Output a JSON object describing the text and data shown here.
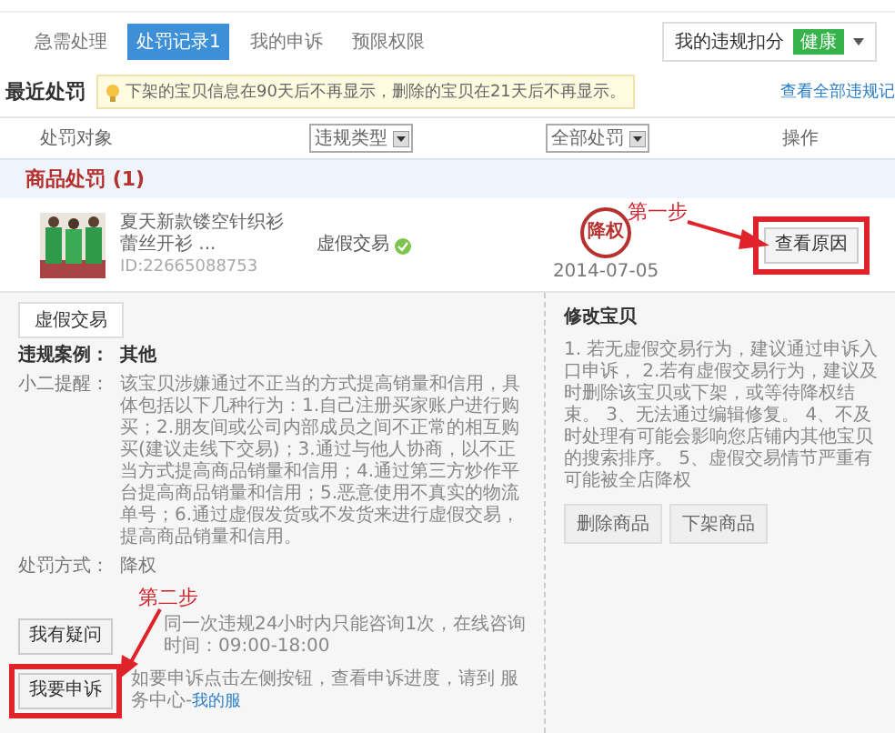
{
  "tabs": [
    {
      "label": "急需处理",
      "selected": false
    },
    {
      "label": "处罚记录1",
      "selected": true
    },
    {
      "label": "我的申诉",
      "selected": false
    },
    {
      "label": "预限权限",
      "selected": false
    }
  ],
  "score_menu": {
    "label": "我的违规扣分",
    "badge": "健康"
  },
  "recent": {
    "title": "最近处罚",
    "tip": "下架的宝贝信息在90天后不再显示，删除的宝贝在21天后不再显示。",
    "link": "查看全部违规记"
  },
  "columns": [
    {
      "label": "处罚对象",
      "kind": "text"
    },
    {
      "label": "违规类型",
      "kind": "select"
    },
    {
      "label": "全部处罚",
      "kind": "select"
    },
    {
      "label": "操作",
      "kind": "text"
    }
  ],
  "group": {
    "title": "商品处罚 (1)"
  },
  "item": {
    "title": "夏天新款镂空针织衫蕾丝开衫 ...",
    "id": "ID:22665088753",
    "violation": "虚假交易",
    "verified": true,
    "penalty": "降权",
    "date": "2014-07-05",
    "action": "查看原因",
    "highlighted": true
  },
  "detail": {
    "tab": "虚假交易",
    "case_label": "违规案例：",
    "case_value": "其他",
    "reminder_label": "小二提醒：",
    "reminder": "该宝贝涉嫌通过不正当的方式提高销量和信用，具体包括以下几种行为：1.自己注册买家账户进行购买；2.朋友间或公司内部成员之间不正常的相互购买(建议走线下交易)；3.通过与他人协商，以不正当方式提高商品销量和信用；4.通过第三方炒作平台提高商品销量和信用；5.恶意使用不真实的物流单号；6.通过虚假发货或不发货来进行虚假交易，提高商品销量和信用。",
    "method_label": "处罚方式：",
    "method_value": "降权",
    "consult": {
      "button": "我有疑问",
      "note": "同一次违规24小时内只能咨询1次，在线咨询时间：09:00-18:00"
    },
    "appeal": {
      "button": "我要申诉",
      "highlighted": true,
      "note": "如要申诉点击左侧按钮，查看申诉进度，请到 服务中心-",
      "link": "我的服"
    }
  },
  "fix": {
    "title": "修改宝贝",
    "text": "1. 若无虚假交易行为，建议通过申诉入口申诉， 2.若有虚假交易行为，建议及时删除该宝贝或下架，或等待降权结束。 3、无法通过编辑修复。 4、不及时处理有可能会影响您店铺内其他宝贝的搜索排序。 5、虚假交易情节严重有可能被全店降权",
    "buttons": [
      "删除商品",
      "下架商品"
    ]
  },
  "annotations": [
    {
      "label": "第一步"
    },
    {
      "label": "第二步"
    }
  ]
}
